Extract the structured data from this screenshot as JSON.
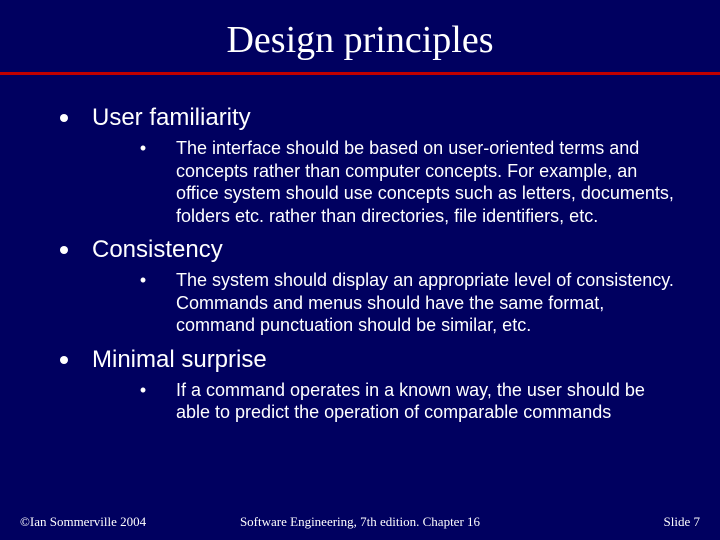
{
  "title": "Design principles",
  "bullets": [
    {
      "heading": "User familiarity",
      "detail": "The interface should be based on user-oriented terms and concepts rather than computer concepts. For example, an office system should use concepts such as letters, documents, folders etc. rather than directories, file identifiers, etc."
    },
    {
      "heading": "Consistency",
      "detail": "The system should display an appropriate level of consistency. Commands and menus should have the same format, command punctuation should be similar, etc."
    },
    {
      "heading": "Minimal surprise",
      "detail": "If a command operates in a known way, the user should be able to predict the operation of comparable commands"
    }
  ],
  "footer": {
    "left": "©Ian Sommerville 2004",
    "center": "Software Engineering, 7th edition. Chapter 16",
    "right": "Slide 7"
  }
}
